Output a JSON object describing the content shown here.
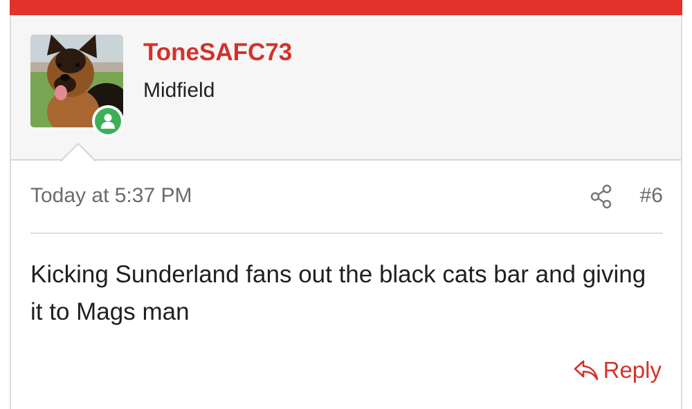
{
  "post": {
    "username": "ToneSAFC73",
    "user_title": "Midfield",
    "timestamp": "Today at 5:37 PM",
    "post_number": "#6",
    "message": "Kicking Sunderland fans out the black cats bar and giving it to Mags man",
    "reply_label": "Reply"
  },
  "icons": {
    "avatar": "german-shepherd-avatar",
    "online": "user-online-icon",
    "share": "share-icon",
    "reply": "reply-arrow-icon"
  },
  "colors": {
    "accent": "#e2322b",
    "username": "#d2322a",
    "online": "#3daf57",
    "meta_text": "#6b6b6b"
  }
}
